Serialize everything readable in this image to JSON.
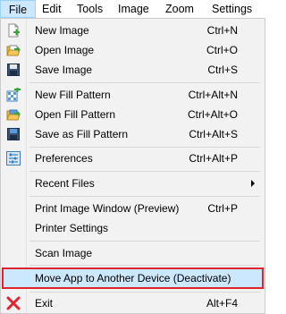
{
  "menubar": {
    "file": "File",
    "edit": "Edit",
    "tools": "Tools",
    "image": "Image",
    "zoom": "Zoom",
    "settings": "Settings"
  },
  "menu": {
    "new_image": {
      "label": "New Image",
      "shortcut": "Ctrl+N",
      "icon": "new-image-icon"
    },
    "open_image": {
      "label": "Open Image",
      "shortcut": "Ctrl+O",
      "icon": "open-image-icon"
    },
    "save_image": {
      "label": "Save Image",
      "shortcut": "Ctrl+S",
      "icon": "save-image-icon"
    },
    "new_fill": {
      "label": "New Fill Pattern",
      "shortcut": "Ctrl+Alt+N",
      "icon": "new-fill-pattern-icon"
    },
    "open_fill": {
      "label": "Open Fill Pattern",
      "shortcut": "Ctrl+Alt+O",
      "icon": "open-fill-pattern-icon"
    },
    "save_fill": {
      "label": "Save as Fill Pattern",
      "shortcut": "Ctrl+Alt+S",
      "icon": "save-fill-pattern-icon"
    },
    "preferences": {
      "label": "Preferences",
      "shortcut": "Ctrl+Alt+P",
      "icon": "preferences-icon"
    },
    "recent_files": {
      "label": "Recent Files"
    },
    "print_preview": {
      "label": "Print Image Window (Preview)",
      "shortcut": "Ctrl+P"
    },
    "printer_settings": {
      "label": "Printer Settings"
    },
    "scan_image": {
      "label": "Scan Image"
    },
    "move_app": {
      "label": "Move App to Another Device (Deactivate)"
    },
    "exit": {
      "label": "Exit",
      "shortcut": "Alt+F4",
      "icon": "exit-icon"
    }
  },
  "colors": {
    "highlight_bg": "#cce8ff",
    "highlight_border": "#e0242f",
    "menu_bg": "#f2f2f2"
  }
}
